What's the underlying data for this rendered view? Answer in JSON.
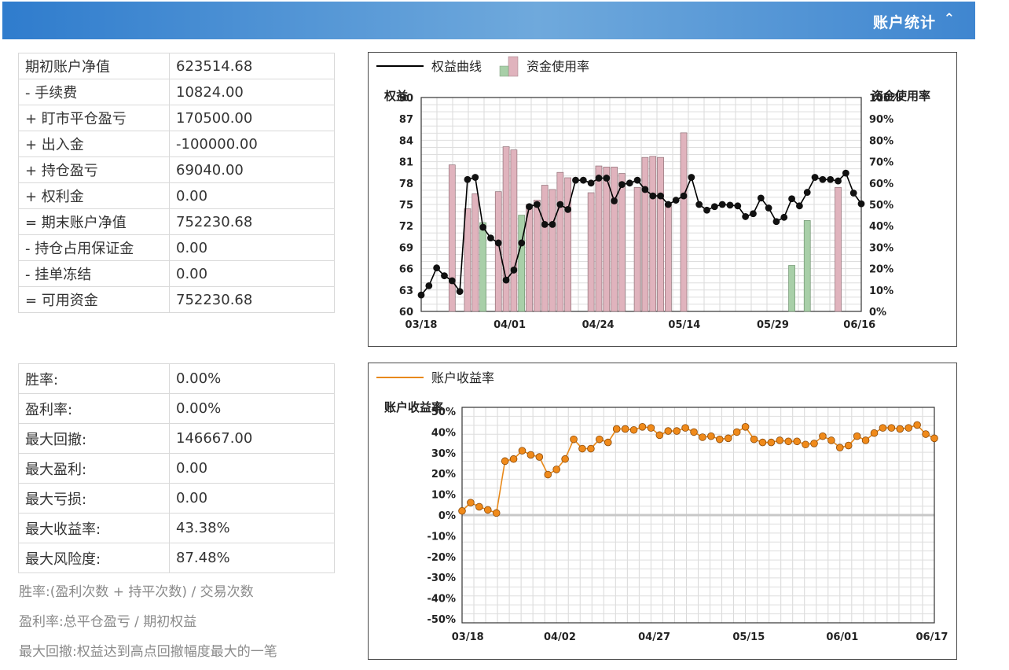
{
  "header": {
    "title": "账户统计",
    "collapse_icon": "double-chevron-up-icon"
  },
  "account_table": [
    {
      "label": "期初账户净值",
      "value": "623514.68"
    },
    {
      "label": "- 手续费",
      "value": "10824.00"
    },
    {
      "label": "+ 盯市平仓盈亏",
      "value": "170500.00"
    },
    {
      "label": "+ 出入金",
      "value": "-100000.00"
    },
    {
      "label": "+ 持仓盈亏",
      "value": "69040.00"
    },
    {
      "label": "+ 权利金",
      "value": "0.00"
    },
    {
      "label": "= 期末账户净值",
      "value": "752230.68"
    },
    {
      "label": "- 持仓占用保证金",
      "value": "0.00"
    },
    {
      "label": "- 挂单冻结",
      "value": "0.00"
    },
    {
      "label": "= 可用资金",
      "value": "752230.68"
    }
  ],
  "performance_table": [
    {
      "label": "胜率:",
      "value": "0.00%"
    },
    {
      "label": "盈利率:",
      "value": "0.00%"
    },
    {
      "label": "最大回撤:",
      "value": "146667.00"
    },
    {
      "label": "最大盈利:",
      "value": "0.00"
    },
    {
      "label": "最大亏损:",
      "value": "0.00"
    },
    {
      "label": "最大收益率:",
      "value": "43.38%"
    },
    {
      "label": "最大风险度:",
      "value": "87.48%"
    }
  ],
  "notes": [
    "胜率:(盈利次数 + 持平次数) / 交易次数",
    "盈利率:总平仓盈亏 / 期初权益",
    "最大回撤:权益达到高点回撤幅度最大的一笔"
  ],
  "colors": {
    "equity_line": "#000000",
    "usage_bar": "#e0b3bd",
    "usage_bar_green": "#a8cfa8",
    "yield_line": "#e8891a",
    "yield_marker": "#f08a1a"
  },
  "chart_data": [
    {
      "type": "line+bar",
      "legend": [
        "权益曲线",
        "资金使用率"
      ],
      "ylabel": "权益",
      "y2label": "资金使用率",
      "ylim": [
        60,
        90
      ],
      "yticks": [
        "90",
        "87",
        "84",
        "81",
        "78",
        "75",
        "72",
        "69",
        "66",
        "63",
        "60"
      ],
      "y2lim": [
        0,
        100
      ],
      "y2ticks": [
        "100%",
        "90%",
        "80%",
        "70%",
        "60%",
        "50%",
        "40%",
        "30%",
        "20%",
        "10%",
        "0%"
      ],
      "xticks": [
        "03/18",
        "04/01",
        "04/24",
        "05/14",
        "05/29",
        "06/16"
      ],
      "equity": [
        62.3,
        63.6,
        66.1,
        65.0,
        64.3,
        62.8,
        78.5,
        78.8,
        71.8,
        70.3,
        69.6,
        64.4,
        65.8,
        69.6,
        74.7,
        75.0,
        72.2,
        72.2,
        75.0,
        74.3,
        78.4,
        78.4,
        78.0,
        78.7,
        78.7,
        75.5,
        77.8,
        78.0,
        78.4,
        77.1,
        76.2,
        76.2,
        75.0,
        75.6,
        76.2,
        78.8,
        75.0,
        74.2,
        74.7,
        75.0,
        74.9,
        74.8,
        73.3,
        73.7,
        75.9,
        74.5,
        72.6,
        73.2,
        75.8,
        74.8,
        76.7,
        78.8,
        78.5,
        78.5,
        78.3,
        79.4,
        76.6,
        75.1
      ],
      "usage_bars": [
        {
          "i": 4,
          "v": 68.5,
          "c": "pink"
        },
        {
          "i": 6,
          "v": 48,
          "c": "pink"
        },
        {
          "i": 7,
          "v": 55,
          "c": "pink"
        },
        {
          "i": 8,
          "v": 41.5,
          "c": "green"
        },
        {
          "i": 10,
          "v": 56,
          "c": "pink"
        },
        {
          "i": 11,
          "v": 77,
          "c": "pink"
        },
        {
          "i": 12,
          "v": 75.5,
          "c": "pink"
        },
        {
          "i": 13,
          "v": 45,
          "c": "green"
        },
        {
          "i": 14,
          "v": 50,
          "c": "pink"
        },
        {
          "i": 15,
          "v": 52,
          "c": "pink"
        },
        {
          "i": 16,
          "v": 59,
          "c": "pink"
        },
        {
          "i": 17,
          "v": 57,
          "c": "pink"
        },
        {
          "i": 18,
          "v": 65,
          "c": "pink"
        },
        {
          "i": 19,
          "v": 62.5,
          "c": "pink"
        },
        {
          "i": 22,
          "v": 55.5,
          "c": "pink"
        },
        {
          "i": 23,
          "v": 68,
          "c": "pink"
        },
        {
          "i": 24,
          "v": 67.5,
          "c": "pink"
        },
        {
          "i": 25,
          "v": 67.5,
          "c": "pink"
        },
        {
          "i": 26,
          "v": 64.5,
          "c": "pink"
        },
        {
          "i": 28,
          "v": 58,
          "c": "pink"
        },
        {
          "i": 29,
          "v": 72,
          "c": "pink"
        },
        {
          "i": 30,
          "v": 72.5,
          "c": "pink"
        },
        {
          "i": 31,
          "v": 72,
          "c": "pink"
        },
        {
          "i": 32,
          "v": 50,
          "c": "pink"
        },
        {
          "i": 34,
          "v": 83.5,
          "c": "pink"
        },
        {
          "i": 48,
          "v": 21.5,
          "c": "green"
        },
        {
          "i": 50,
          "v": 42.5,
          "c": "green"
        },
        {
          "i": 54,
          "v": 58,
          "c": "pink"
        }
      ]
    },
    {
      "type": "line",
      "legend": [
        "账户收益率"
      ],
      "ylabel": "账户收益率",
      "ylim": [
        -50,
        50
      ],
      "yticks": [
        "50%",
        "40%",
        "30%",
        "20%",
        "10%",
        "0%",
        "-10%",
        "-20%",
        "-30%",
        "-40%",
        "-50%"
      ],
      "xticks": [
        "03/18",
        "04/02",
        "04/27",
        "05/15",
        "06/01",
        "06/17"
      ],
      "values": [
        2,
        6,
        4,
        2.5,
        1,
        26,
        27,
        31,
        29,
        28,
        19.5,
        22,
        27,
        36.5,
        32,
        32,
        36.5,
        35,
        41.5,
        41.5,
        41,
        42.5,
        42,
        38.5,
        40.5,
        40.5,
        42,
        40,
        37.5,
        38,
        36.5,
        37,
        40,
        42.5,
        36.5,
        35,
        35,
        36,
        35.5,
        35.5,
        34,
        34.5,
        38,
        36,
        32.5,
        33.5,
        38,
        36,
        39.5,
        42,
        42,
        41.5,
        42,
        43.4,
        39,
        37
      ]
    }
  ]
}
